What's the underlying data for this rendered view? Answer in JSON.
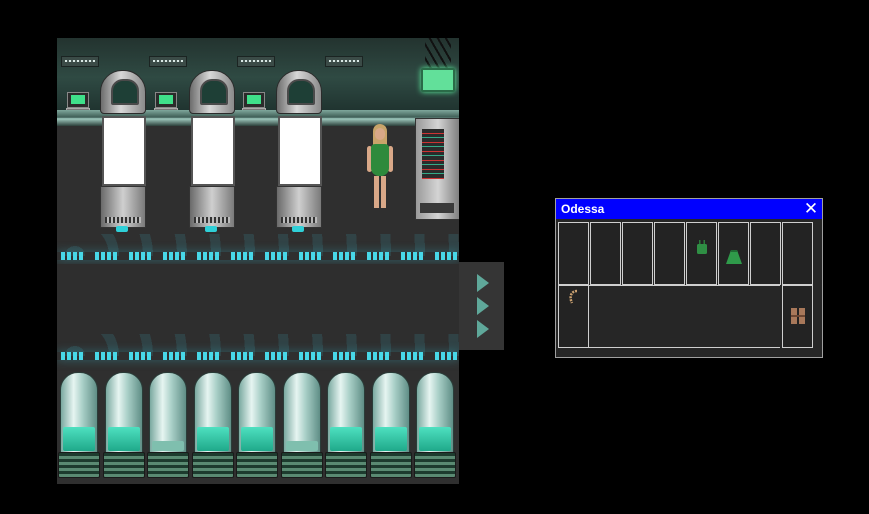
{
  "inventory": {
    "title": "Odessa",
    "close_glyph": "✕",
    "top_row_slots": 8,
    "bottom_row_slots": 2,
    "items": [
      {
        "name": "green-top-icon",
        "slot": "top-5"
      },
      {
        "name": "green-skirt-icon",
        "slot": "top-6"
      },
      {
        "name": "bracelet-icon",
        "slot": "bottom-1"
      },
      {
        "name": "brown-shoes-icon",
        "slot": "bottom-2"
      }
    ]
  },
  "scene": {
    "pods": 3,
    "tubes": 9,
    "lit_tubes": [
      true,
      true,
      false,
      true,
      true,
      false,
      true,
      true,
      true
    ]
  },
  "scroll_panel": {
    "arrows": [
      "right-arrow-icon",
      "right-arrow-icon",
      "right-arrow-icon"
    ],
    "arrow_color": "#5fa89a"
  },
  "colors": {
    "titlebar": "#0000ff",
    "background": "#000000",
    "accent_glow": "#48d8e8"
  }
}
